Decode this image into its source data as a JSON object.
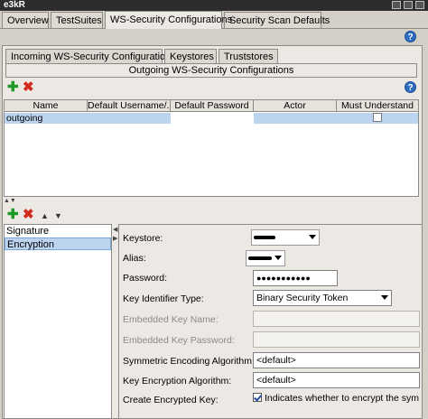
{
  "window": {
    "title": "e3kR"
  },
  "main_tabs": [
    {
      "label": "Overview"
    },
    {
      "label": "TestSuites"
    },
    {
      "label": "WS-Security Configurations",
      "active": true
    },
    {
      "label": "Security Scan Defaults"
    }
  ],
  "help_icon": "?",
  "sub_tabs": [
    {
      "label": "Incoming WS-Security Configurations"
    },
    {
      "label": "Keystores"
    },
    {
      "label": "Truststores"
    }
  ],
  "active_sub_tab": {
    "label": "Outgoing WS-Security Configurations"
  },
  "toolbar": {
    "add_icon": "plus-icon",
    "remove_icon": "remove-icon",
    "add_symbol": "✚",
    "remove_symbol": "✖"
  },
  "table": {
    "columns": [
      "Name",
      "Default Username/...",
      "Default Password",
      "Actor",
      "Must Understand"
    ],
    "rows": [
      {
        "name": "outgoing",
        "default_username": "",
        "default_password": "",
        "actor": "",
        "must_understand": false
      }
    ]
  },
  "entry_toolbar": {
    "add_symbol": "✚",
    "remove_symbol": "✖",
    "up_symbol": "▲",
    "down_symbol": "▼"
  },
  "entries": [
    {
      "label": "Signature",
      "selected": false
    },
    {
      "label": "Encryption",
      "selected": true
    }
  ],
  "form": {
    "keystore_label": "Keystore:",
    "alias_label": "Alias:",
    "password_label": "Password:",
    "password_value": "●●●●●●●●●●●",
    "key_identifier_label": "Key Identifier Type:",
    "key_identifier_value": "Binary Security Token",
    "embedded_key_name_label": "Embedded Key Name:",
    "embedded_key_password_label": "Embedded Key Password:",
    "sym_enc_alg_label": "Symmetric Encoding Algorithm:",
    "sym_enc_alg_value": "<default>",
    "key_enc_alg_label": "Key Encryption Algorithm:",
    "key_enc_alg_value": "<default>",
    "create_enc_key_label": "Create Encrypted Key:",
    "create_enc_key_text": "Indicates whether to encrypt the sym",
    "create_enc_key_checked": true
  }
}
